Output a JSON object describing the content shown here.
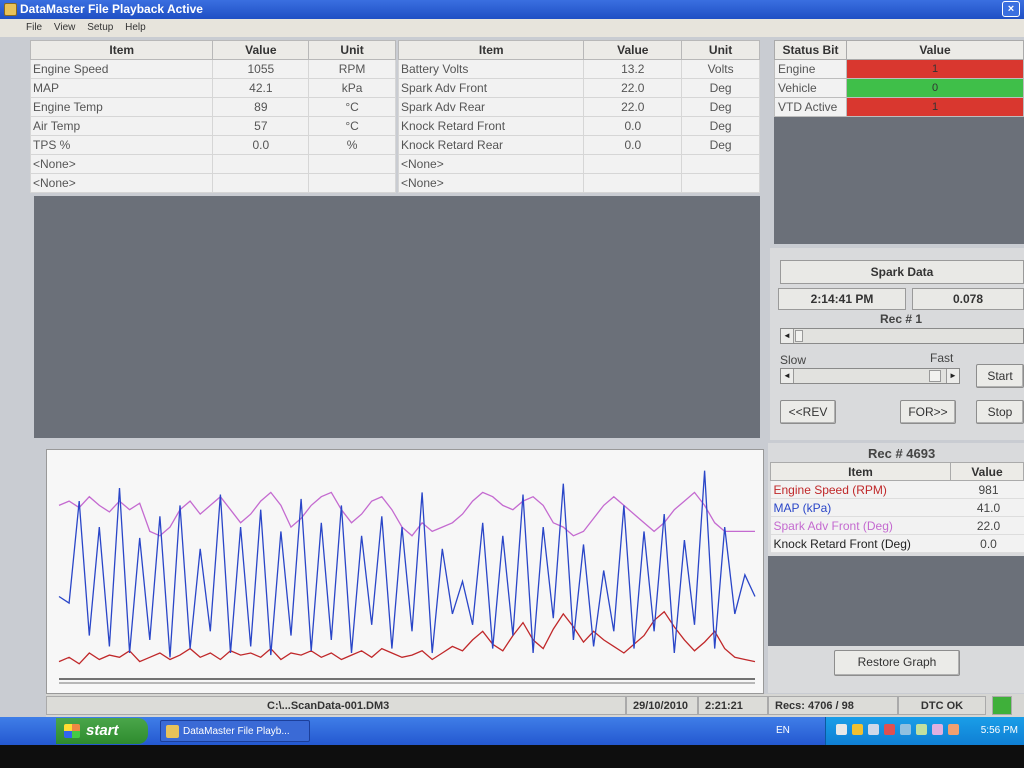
{
  "window": {
    "title": "DataMaster File Playback Active",
    "close_glyph": "×"
  },
  "menu": [
    "File",
    "View",
    "Setup",
    "Help"
  ],
  "table1": {
    "headers": [
      "Item",
      "Value",
      "Unit"
    ],
    "rows": [
      [
        "Engine Speed",
        "1055",
        "RPM"
      ],
      [
        "MAP",
        "42.1",
        "kPa"
      ],
      [
        "Engine Temp",
        "89",
        "°C"
      ],
      [
        "Air Temp",
        "57",
        "°C"
      ],
      [
        "TPS %",
        "0.0",
        "%"
      ],
      [
        "<None>",
        "",
        ""
      ],
      [
        "<None>",
        "",
        ""
      ]
    ]
  },
  "table2": {
    "headers": [
      "Item",
      "Value",
      "Unit"
    ],
    "rows": [
      [
        "Battery Volts",
        "13.2",
        "Volts"
      ],
      [
        "Spark Adv Front",
        "22.0",
        "Deg"
      ],
      [
        "Spark Adv Rear",
        "22.0",
        "Deg"
      ],
      [
        "Knock Retard Front",
        "0.0",
        "Deg"
      ],
      [
        "Knock Retard Rear",
        "0.0",
        "Deg"
      ],
      [
        "<None>",
        "",
        ""
      ],
      [
        "<None>",
        "",
        ""
      ]
    ]
  },
  "status_bits": {
    "headers": [
      "Status Bit",
      "Value"
    ],
    "rows": [
      {
        "label": "Engine",
        "value": "1",
        "color": "#d9372f"
      },
      {
        "label": "Vehicle",
        "value": "0",
        "color": "#3fbf49"
      },
      {
        "label": "VTD Active",
        "value": "1",
        "color": "#d9372f"
      }
    ]
  },
  "spark": {
    "title": "Spark Data",
    "time": "2:14:41 PM",
    "value": "0.078",
    "rec_label": "Rec # 1",
    "slow_label": "Slow",
    "fast_label": "Fast",
    "rev_button": "<<REV",
    "for_button": "FOR>>",
    "start_button": "Start",
    "stop_button": "Stop",
    "left_arrow": "◄",
    "right_arrow": "►"
  },
  "legend": {
    "rec_label": "Rec # 4693",
    "headers": [
      "Item",
      "Value"
    ],
    "rows": [
      {
        "label": "Engine Speed (RPM)",
        "value": "981",
        "color": "#c0282a"
      },
      {
        "label": "MAP (kPa)",
        "value": "41.0",
        "color": "#2a46c8"
      },
      {
        "label": "Spark Adv Front (Deg)",
        "value": "22.0",
        "color": "#c46ad0"
      },
      {
        "label": "Knock Retard Front (Deg)",
        "value": "0.0",
        "color": "#222222"
      }
    ],
    "restore_button": "Restore Graph"
  },
  "statusbar": {
    "file": "C:\\...ScanData-001.DM3",
    "date": "29/10/2010",
    "time": "2:21:21 PM",
    "recs": "Recs: 4706 / 98",
    "dtc": "DTC OK",
    "dtc_color": "#3fb03a"
  },
  "taskbar": {
    "start": "start",
    "task_item": "DataMaster File Playb...",
    "lang": "EN",
    "clock": "5:56 PM"
  },
  "chart_data": {
    "type": "line",
    "title": "",
    "xlabel": "",
    "ylabel": "",
    "x": [
      0,
      10,
      20,
      30,
      40,
      50,
      60,
      70,
      80,
      90,
      100,
      110,
      120,
      130,
      140,
      150,
      160,
      170,
      180,
      190,
      200,
      210,
      220,
      230,
      240,
      250,
      260,
      270,
      280,
      290,
      300,
      310,
      320,
      330,
      340,
      350,
      360,
      370,
      380,
      390,
      400,
      410,
      420,
      430,
      440,
      450,
      460,
      470,
      480,
      490,
      500,
      510,
      520,
      530,
      540,
      550,
      560,
      570,
      580,
      590,
      600,
      610,
      620,
      630,
      640,
      650,
      660,
      670,
      680,
      690
    ],
    "xlim": [
      0,
      690
    ],
    "ylim": [
      0,
      100
    ],
    "grid": false,
    "series": [
      {
        "name": "Engine Speed (RPM)",
        "color": "#c0282a",
        "values": [
          8,
          10,
          7,
          12,
          9,
          11,
          10,
          13,
          8,
          10,
          12,
          9,
          11,
          14,
          10,
          12,
          9,
          13,
          11,
          12,
          10,
          14,
          9,
          12,
          11,
          13,
          10,
          12,
          9,
          11,
          13,
          10,
          14,
          12,
          10,
          11,
          13,
          9,
          12,
          15,
          13,
          18,
          22,
          16,
          13,
          20,
          26,
          18,
          14,
          23,
          30,
          24,
          17,
          22,
          18,
          15,
          12,
          16,
          20,
          27,
          31,
          24,
          18,
          13,
          17,
          22,
          14,
          10,
          9,
          8
        ]
      },
      {
        "name": "MAP (kPa)",
        "color": "#2a46c8",
        "values": [
          38,
          35,
          82,
          20,
          70,
          15,
          88,
          12,
          65,
          18,
          75,
          10,
          80,
          14,
          60,
          22,
          85,
          12,
          70,
          15,
          78,
          11,
          68,
          20,
          83,
          13,
          72,
          18,
          80,
          12,
          66,
          25,
          75,
          14,
          70,
          22,
          86,
          12,
          60,
          30,
          45,
          25,
          72,
          14,
          66,
          20,
          85,
          12,
          70,
          28,
          90,
          18,
          62,
          15,
          50,
          22,
          80,
          14,
          68,
          22,
          76,
          12,
          64,
          25,
          96,
          14,
          70,
          30,
          48,
          38
        ]
      },
      {
        "name": "Spark Adv Front (Deg)",
        "color": "#c46ad0",
        "values": [
          80,
          82,
          79,
          84,
          80,
          77,
          82,
          78,
          81,
          68,
          66,
          70,
          78,
          82,
          76,
          80,
          84,
          78,
          72,
          76,
          82,
          86,
          80,
          70,
          74,
          80,
          84,
          86,
          78,
          72,
          76,
          82,
          84,
          78,
          70,
          66,
          72,
          68,
          70,
          72,
          76,
          82,
          86,
          84,
          80,
          78,
          82,
          84,
          80,
          72,
          70,
          66,
          68,
          74,
          80,
          84,
          80,
          76,
          72,
          68,
          72,
          78,
          82,
          86,
          80,
          72,
          68,
          68,
          68,
          68
        ]
      },
      {
        "name": "Knock Retard Front (Deg)",
        "color": "#222222",
        "values": [
          0,
          0,
          0,
          0,
          0,
          0,
          0,
          0,
          0,
          0,
          0,
          0,
          0,
          0,
          0,
          0,
          0,
          0,
          0,
          0,
          0,
          0,
          0,
          0,
          0,
          0,
          0,
          0,
          0,
          0,
          0,
          0,
          0,
          0,
          0,
          0,
          0,
          0,
          0,
          0,
          0,
          0,
          0,
          0,
          0,
          0,
          0,
          0,
          0,
          0,
          0,
          0,
          0,
          0,
          0,
          0,
          0,
          0,
          0,
          0,
          0,
          0,
          0,
          0,
          0,
          0,
          0,
          0,
          0,
          0
        ]
      }
    ]
  }
}
